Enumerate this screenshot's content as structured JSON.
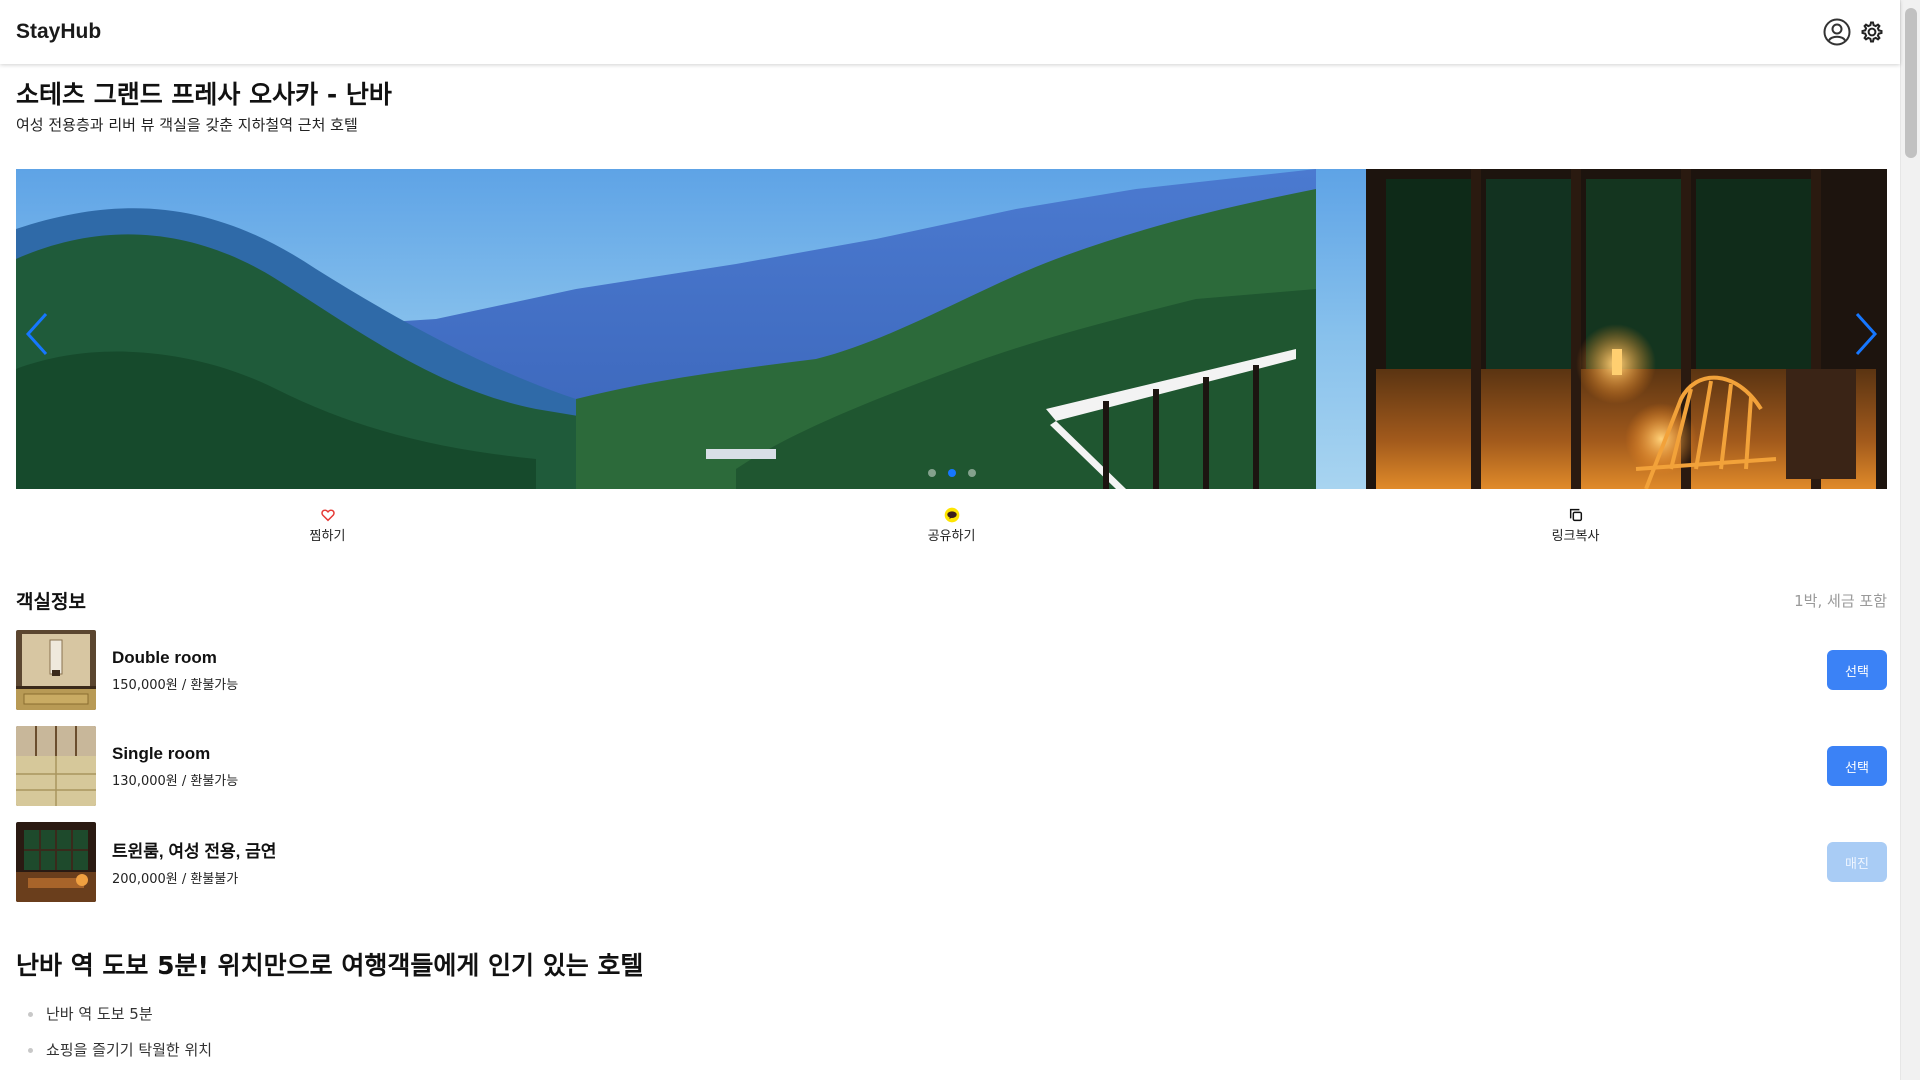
{
  "header": {
    "brand": "StayHub",
    "icons": [
      "user-circle-icon",
      "gear-icon"
    ]
  },
  "hotel": {
    "title": "소테츠 그랜드 프레사 오사카 - 난바",
    "subtitle": "여성 전용층과 리버 뷰 객실을 갖춘 지하철역 근처 호텔"
  },
  "carousel": {
    "total_slides": 3,
    "active_index": 1
  },
  "actions": [
    {
      "label": "찜하기",
      "icon": "heart-icon",
      "color": "#e53935"
    },
    {
      "label": "공유하기",
      "icon": "kakao-talk-icon",
      "color": "#fee500"
    },
    {
      "label": "링크복사",
      "icon": "copy-icon",
      "color": "#111111"
    }
  ],
  "rooms_section": {
    "title": "객실정보",
    "note": "1박, 세금 포함"
  },
  "rooms": [
    {
      "name": "Double room",
      "meta": "150,000원 / 환불가능",
      "button": "선택",
      "available": true
    },
    {
      "name": "Single room",
      "meta": "130,000원 / 환불가능",
      "button": "선택",
      "available": true
    },
    {
      "name": "트윈룸, 여성 전용, 금연",
      "meta": "200,000원 / 환불불가",
      "button": "매진",
      "available": false
    }
  ],
  "description": {
    "headline": "난바 역 도보 5분! 위치만으로 여행객들에게 인기 있는 호텔",
    "features": [
      "난바 역 도보 5분",
      "쇼핑을 즐기기 탁월한 위치"
    ]
  },
  "colors": {
    "primary": "#3b82f6",
    "disabled": "#a9ccf5",
    "accent": "#1677ff"
  }
}
